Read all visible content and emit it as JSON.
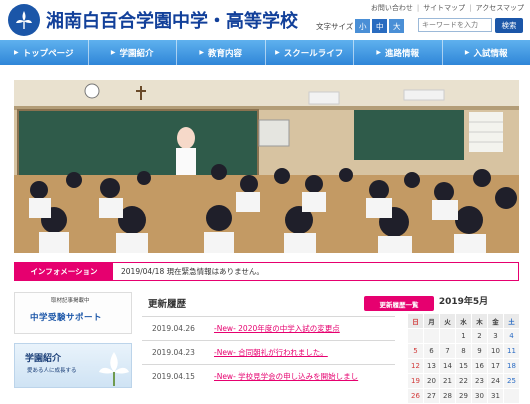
{
  "site": {
    "title": "湘南白百合学園中学・高等学校",
    "brand_color": "#1b56a8",
    "accent_color": "#e6006f"
  },
  "util_links": [
    "お問い合わせ",
    "サイトマップ",
    "アクセスマップ"
  ],
  "font_size": {
    "label": "文字サイズ",
    "options": [
      "小",
      "中",
      "大"
    ],
    "selected": "中"
  },
  "search": {
    "placeholder": "キーワードを入力",
    "button": "検索"
  },
  "nav": [
    "トップページ",
    "学園紹介",
    "教育内容",
    "スクールライフ",
    "進路情報",
    "入試情報"
  ],
  "info": {
    "label": "インフォメーション",
    "text": "2019/04/18 現在緊急情報はありません。"
  },
  "banners": {
    "b1_top": "取材記事掲載中",
    "b1_main": "中学受験サポート",
    "b2_title": "学園紹介",
    "b2_sub": "愛ある人に成長する"
  },
  "updates": {
    "title": "更新履歴",
    "more": "更新履歴一覧",
    "items": [
      {
        "date": "2019.04.26",
        "text": "-New- 2020年度の中学入試の変更点"
      },
      {
        "date": "2019.04.23",
        "text": "-New- 合同朝礼が行われました。"
      },
      {
        "date": "2019.04.15",
        "text": "-New- 学校見学会の申し込みを開始しまし"
      }
    ]
  },
  "calendar": {
    "title": "2019年5月",
    "weekdays": [
      "日",
      "月",
      "火",
      "水",
      "木",
      "金",
      "土"
    ],
    "weeks": [
      [
        "",
        "",
        "",
        "1",
        "2",
        "3",
        "4"
      ],
      [
        "5",
        "6",
        "7",
        "8",
        "9",
        "10",
        "11"
      ],
      [
        "12",
        "13",
        "14",
        "15",
        "16",
        "17",
        "18"
      ],
      [
        "19",
        "20",
        "21",
        "22",
        "23",
        "24",
        "25"
      ],
      [
        "26",
        "27",
        "28",
        "29",
        "30",
        "31",
        ""
      ]
    ]
  }
}
